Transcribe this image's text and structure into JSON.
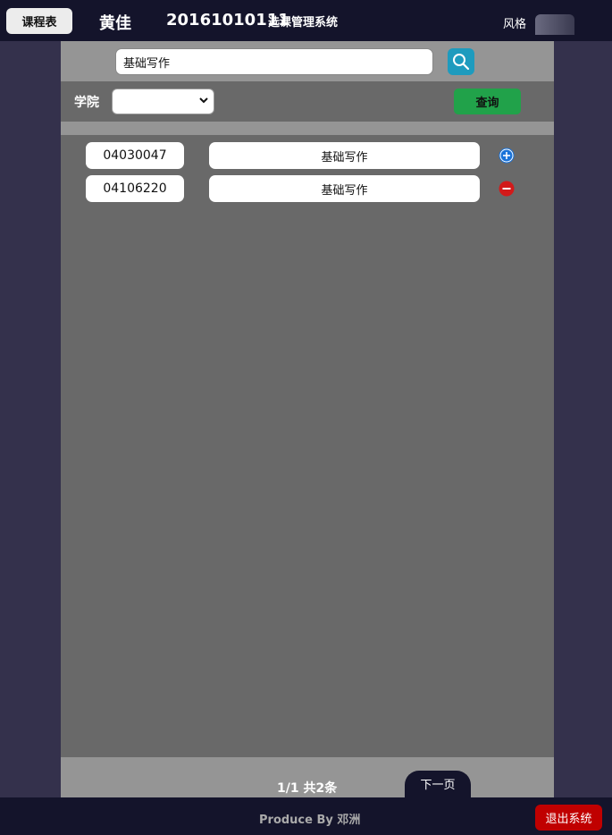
{
  "header": {
    "schedule_label": "课程表",
    "user_name": "黄佳",
    "user_id": "20161010111",
    "system_title": "选课管理系统",
    "style_label": "风格"
  },
  "search": {
    "value": "基础写作",
    "icon": "search-icon",
    "accent": "#1e9bbe"
  },
  "filter": {
    "college_label": "学院",
    "college_selected": "",
    "query_label": "查询",
    "query_color": "#21a24a"
  },
  "courses": [
    {
      "code": "04030047",
      "name": "基础写作",
      "action": "add",
      "action_icon": "plus-circle-icon",
      "action_color": "#1a73d9"
    },
    {
      "code": "04106220",
      "name": "基础写作",
      "action": "remove",
      "action_icon": "minus-circle-icon",
      "action_color": "#d21a1a"
    }
  ],
  "pager": {
    "info": "1/1 共2条",
    "next_label": "下一页"
  },
  "footer": {
    "produce": "Produce By 邓洲",
    "logout_label": "退出系统",
    "logout_color": "#c00000"
  }
}
